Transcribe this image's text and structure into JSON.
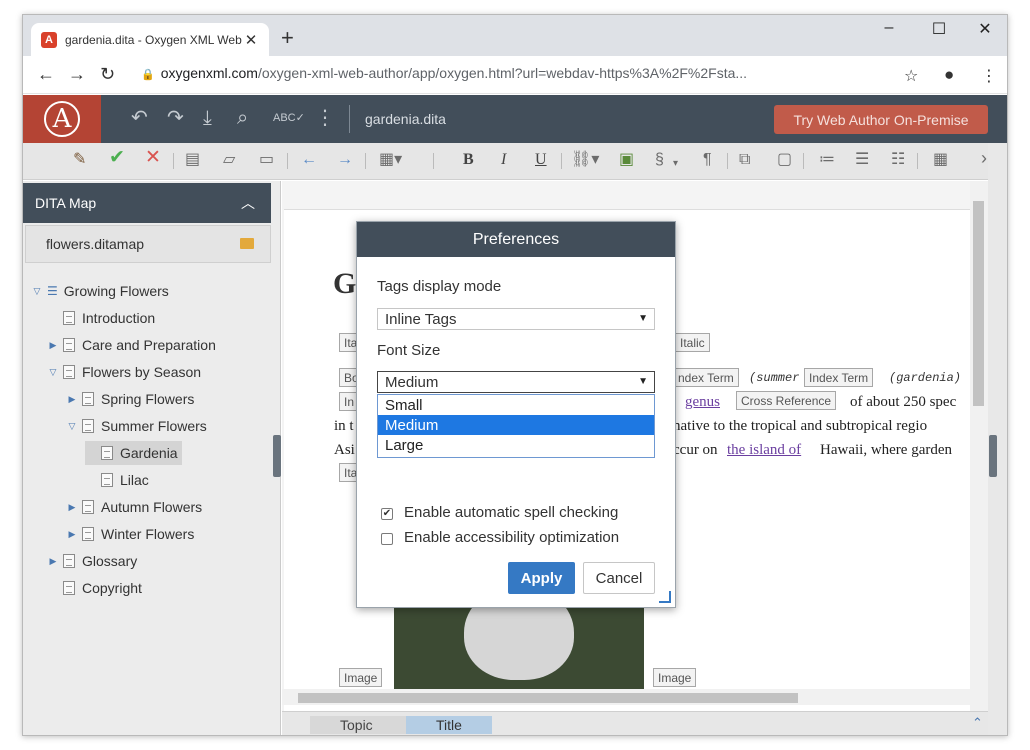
{
  "browser": {
    "tab_title": "gardenia.dita - Oxygen XML Web",
    "tab_favicon": "A",
    "new_tab": "+",
    "url_host": "oxygenxml.com",
    "url_path": "/oxygen-xml-web-author/app/oxygen.html?url=webdav-https%3A%2F%2Fsta..."
  },
  "app": {
    "doc_name": "gardenia.dita",
    "try_button": "Try Web Author On-Premise",
    "accent": "#c15b4a",
    "header_bg": "#424e5a"
  },
  "toolbar": {
    "bold": "B",
    "italic": "I",
    "underline": "U",
    "section": "§",
    "pilcrow": "¶"
  },
  "sidebar": {
    "title": "DITA Map",
    "map_file": "flowers.ditamap",
    "items": [
      {
        "label": "Growing Flowers"
      },
      {
        "label": "Introduction"
      },
      {
        "label": "Care and Preparation"
      },
      {
        "label": "Flowers by Season"
      },
      {
        "label": "Spring Flowers"
      },
      {
        "label": "Summer Flowers"
      },
      {
        "label": "Gardenia"
      },
      {
        "label": "Lilac"
      },
      {
        "label": "Autumn Flowers"
      },
      {
        "label": "Winter Flowers"
      },
      {
        "label": "Glossary"
      },
      {
        "label": "Copyright"
      }
    ]
  },
  "editor": {
    "heading_partial": "G",
    "tag_italic_left": "Ita",
    "tag_italic_right": "Italic",
    "tag_bold_left": "Bo",
    "tag_index_term_1": "ndex Term",
    "summer_text": "(summer",
    "tag_index_term_2": "Index Term",
    "gardenia_text": "(gardenia)",
    "tag_in": "In",
    "genus_link": "genus",
    "tag_cross_ref": "Cross Reference",
    "line1_tail": "of about 250 spec",
    "line2_head": "in t",
    "line2_tail": "native to the tropical and subtropical regio",
    "line3_head": "Asi",
    "line3_mid": "ccur on",
    "island_link": "the island of",
    "line3_tail": "Hawaii, where garden",
    "tag_ita_3": "Ita",
    "tag_image_left": "Image",
    "tag_image_right": "Image"
  },
  "breadcrumb": {
    "items": [
      "Topic",
      "Title"
    ]
  },
  "dialog": {
    "title": "Preferences",
    "tags_label": "Tags display mode",
    "tags_value": "Inline Tags",
    "font_label": "Font Size",
    "font_value": "Medium",
    "font_options": [
      "Small",
      "Medium",
      "Large"
    ],
    "spell_label": "Enable automatic spell checking",
    "spell_checked": true,
    "access_label": "Enable accessibility optimization",
    "access_checked": false,
    "apply": "Apply",
    "cancel": "Cancel"
  }
}
